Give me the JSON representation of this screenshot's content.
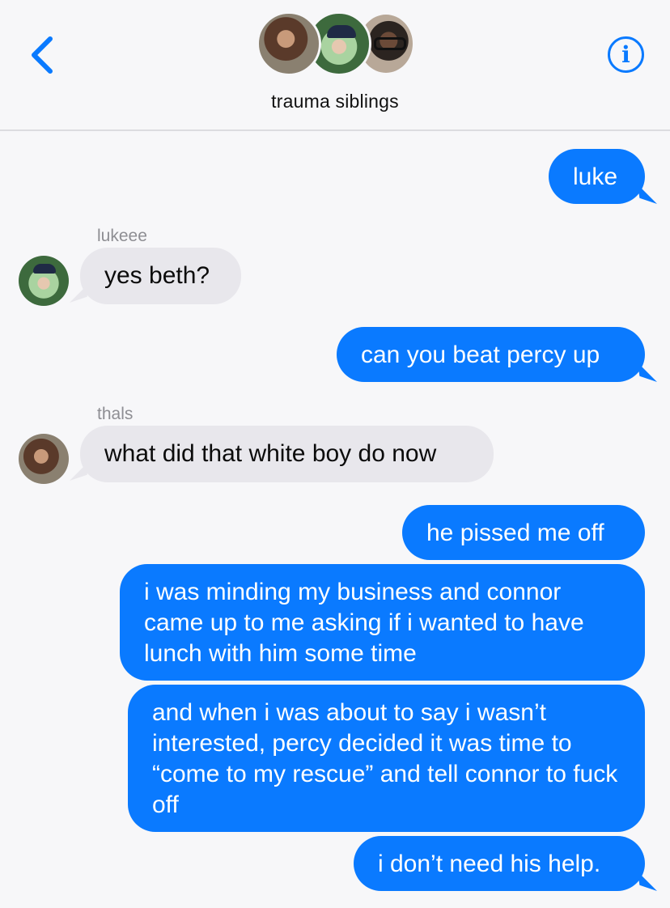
{
  "header": {
    "group_name": "trauma siblings",
    "back_icon": "chevron-left-icon",
    "info_icon": "info-icon",
    "info_glyph": "i",
    "accent_color": "#0a7aff"
  },
  "messages": [
    {
      "from": "me",
      "text": "luke"
    },
    {
      "from": "lukeee",
      "sender_label": "lukeee",
      "text": "yes beth?"
    },
    {
      "from": "me",
      "text": "can you beat percy up"
    },
    {
      "from": "thals",
      "sender_label": "thals",
      "text": "what did that white boy do now"
    },
    {
      "from": "me",
      "text": "he pissed me off"
    },
    {
      "from": "me",
      "text": "i was minding my business and connor came up to me asking if i wanted to have lunch with him some time"
    },
    {
      "from": "me",
      "text": "and when i was about to say i wasn’t interested, percy decided it was time to “come to my rescue” and tell connor to fuck off"
    },
    {
      "from": "me",
      "text": "i don’t need his help."
    }
  ],
  "colors": {
    "sent_bubble": "#0a7aff",
    "received_bubble": "#e8e7ec",
    "background": "#f7f7f9"
  }
}
